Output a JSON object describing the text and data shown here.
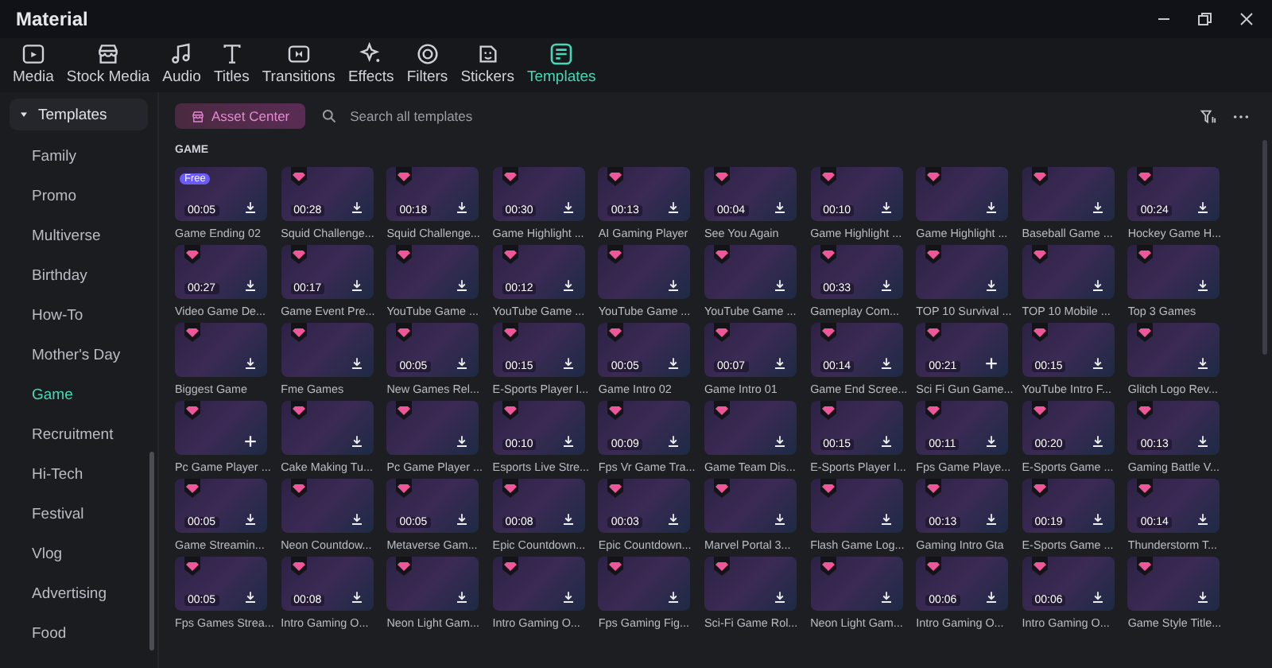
{
  "window": {
    "title": "Material"
  },
  "toolbar": [
    {
      "label": "Media",
      "selected": false
    },
    {
      "label": "Stock Media",
      "selected": false
    },
    {
      "label": "Audio",
      "selected": false
    },
    {
      "label": "Titles",
      "selected": false
    },
    {
      "label": "Transitions",
      "selected": false
    },
    {
      "label": "Effects",
      "selected": false
    },
    {
      "label": "Filters",
      "selected": false
    },
    {
      "label": "Stickers",
      "selected": false
    },
    {
      "label": "Templates",
      "selected": true
    }
  ],
  "sidebar": {
    "header": {
      "label": "Templates",
      "expanded": true
    },
    "items": [
      {
        "label": "Family",
        "selected": false
      },
      {
        "label": "Promo",
        "selected": false
      },
      {
        "label": "Multiverse",
        "selected": false
      },
      {
        "label": "Birthday",
        "selected": false
      },
      {
        "label": "How-To",
        "selected": false
      },
      {
        "label": "Mother's Day",
        "selected": false
      },
      {
        "label": "Game",
        "selected": true
      },
      {
        "label": "Recruitment",
        "selected": false
      },
      {
        "label": "Hi-Tech",
        "selected": false
      },
      {
        "label": "Festival",
        "selected": false
      },
      {
        "label": "Vlog",
        "selected": false
      },
      {
        "label": "Advertising",
        "selected": false
      },
      {
        "label": "Food",
        "selected": false
      }
    ]
  },
  "asset_center": "Asset Center",
  "search": {
    "placeholder": "Search all templates"
  },
  "section_title": "GAME",
  "templates": [
    {
      "title": "Game Ending 02",
      "duration": "00:05",
      "badge": {
        "kind": "free",
        "label": "Free"
      },
      "kind": "download"
    },
    {
      "title": "Squid Challenge...",
      "duration": "00:28",
      "badge": {
        "kind": "premium"
      },
      "kind": "download"
    },
    {
      "title": "Squid Challenge...",
      "duration": "00:18",
      "badge": {
        "kind": "premium"
      },
      "kind": "download"
    },
    {
      "title": "Game Highlight ...",
      "duration": "00:30",
      "badge": {
        "kind": "premium"
      },
      "kind": "download"
    },
    {
      "title": "AI Gaming Player",
      "duration": "00:13",
      "badge": {
        "kind": "premium"
      },
      "kind": "download"
    },
    {
      "title": "See You Again",
      "duration": "00:04",
      "badge": {
        "kind": "premium"
      },
      "kind": "download"
    },
    {
      "title": "Game Highlight ...",
      "duration": "00:10",
      "badge": {
        "kind": "premium"
      },
      "kind": "download"
    },
    {
      "title": "Game Highlight ...",
      "badge": {
        "kind": "premium"
      },
      "kind": "download"
    },
    {
      "title": "Baseball Game ...",
      "badge": {
        "kind": "premium"
      },
      "kind": "download"
    },
    {
      "title": "Hockey Game H...",
      "duration": "00:24",
      "badge": {
        "kind": "premium"
      },
      "kind": "download"
    },
    {
      "title": "Video Game De...",
      "duration": "00:27",
      "badge": {
        "kind": "premium"
      },
      "kind": "download"
    },
    {
      "title": "Game Event Pre...",
      "duration": "00:17",
      "badge": {
        "kind": "premium"
      },
      "kind": "download"
    },
    {
      "title": "YouTube Game ...",
      "badge": {
        "kind": "premium"
      },
      "kind": "download"
    },
    {
      "title": "YouTube Game ...",
      "duration": "00:12",
      "badge": {
        "kind": "premium"
      },
      "kind": "download"
    },
    {
      "title": "YouTube Game ...",
      "badge": {
        "kind": "premium"
      },
      "kind": "download"
    },
    {
      "title": "YouTube Game ...",
      "badge": {
        "kind": "premium"
      },
      "kind": "download"
    },
    {
      "title": "Gameplay Com...",
      "duration": "00:33",
      "badge": {
        "kind": "premium"
      },
      "kind": "download"
    },
    {
      "title": "TOP 10 Survival ...",
      "badge": {
        "kind": "premium"
      },
      "kind": "download"
    },
    {
      "title": "TOP 10 Mobile ...",
      "badge": {
        "kind": "premium"
      },
      "kind": "download"
    },
    {
      "title": "Top 3 Games",
      "badge": {
        "kind": "premium"
      },
      "kind": "download"
    },
    {
      "title": "Biggest Game",
      "badge": {
        "kind": "premium"
      },
      "kind": "download"
    },
    {
      "title": "Fme Games",
      "badge": {
        "kind": "premium"
      },
      "kind": "download"
    },
    {
      "title": "New Games Rel...",
      "duration": "00:05",
      "badge": {
        "kind": "premium"
      },
      "kind": "download"
    },
    {
      "title": "E-Sports Player I...",
      "duration": "00:15",
      "badge": {
        "kind": "premium"
      },
      "kind": "download"
    },
    {
      "title": "Game Intro 02",
      "duration": "00:05",
      "badge": {
        "kind": "premium"
      },
      "kind": "download"
    },
    {
      "title": "Game Intro 01",
      "duration": "00:07",
      "badge": {
        "kind": "premium"
      },
      "kind": "download"
    },
    {
      "title": "Game End Scree...",
      "duration": "00:14",
      "badge": {
        "kind": "premium"
      },
      "kind": "download"
    },
    {
      "title": "Sci Fi Gun Game...",
      "duration": "00:21",
      "badge": {
        "kind": "premium"
      },
      "kind": "add"
    },
    {
      "title": "YouTube Intro F...",
      "duration": "00:15",
      "badge": {
        "kind": "premium"
      },
      "kind": "download"
    },
    {
      "title": "Glitch Logo Rev...",
      "badge": {
        "kind": "premium"
      },
      "kind": "download"
    },
    {
      "title": "Pc Game Player ...",
      "badge": {
        "kind": "premium"
      },
      "kind": "add"
    },
    {
      "title": "Cake Making Tu...",
      "badge": {
        "kind": "premium"
      },
      "kind": "download"
    },
    {
      "title": "Pc Game Player ...",
      "badge": {
        "kind": "premium"
      },
      "kind": "download"
    },
    {
      "title": "Esports Live Stre...",
      "duration": "00:10",
      "badge": {
        "kind": "premium"
      },
      "kind": "download"
    },
    {
      "title": "Fps Vr Game Tra...",
      "duration": "00:09",
      "badge": {
        "kind": "premium"
      },
      "kind": "download"
    },
    {
      "title": "Game Team Dis...",
      "badge": {
        "kind": "premium"
      },
      "kind": "download"
    },
    {
      "title": "E-Sports Player I...",
      "duration": "00:15",
      "badge": {
        "kind": "premium"
      },
      "kind": "download"
    },
    {
      "title": "Fps Game Playe...",
      "duration": "00:11",
      "badge": {
        "kind": "premium"
      },
      "kind": "download"
    },
    {
      "title": "E-Sports Game ...",
      "duration": "00:20",
      "badge": {
        "kind": "premium"
      },
      "kind": "download"
    },
    {
      "title": "Gaming Battle V...",
      "duration": "00:13",
      "badge": {
        "kind": "premium"
      },
      "kind": "download"
    },
    {
      "title": "Game Streamin...",
      "duration": "00:05",
      "badge": {
        "kind": "premium"
      },
      "kind": "download"
    },
    {
      "title": "Neon Countdow...",
      "badge": {
        "kind": "premium"
      },
      "kind": "download"
    },
    {
      "title": "Metaverse Gam...",
      "duration": "00:05",
      "badge": {
        "kind": "premium"
      },
      "kind": "download"
    },
    {
      "title": "Epic Countdown...",
      "duration": "00:08",
      "badge": {
        "kind": "premium"
      },
      "kind": "download"
    },
    {
      "title": "Epic Countdown...",
      "duration": "00:03",
      "badge": {
        "kind": "premium"
      },
      "kind": "download"
    },
    {
      "title": "Marvel Portal 3...",
      "badge": {
        "kind": "premium"
      },
      "kind": "download"
    },
    {
      "title": "Flash Game Log...",
      "badge": {
        "kind": "premium"
      },
      "kind": "download"
    },
    {
      "title": "Gaming Intro Gta",
      "duration": "00:13",
      "badge": {
        "kind": "premium"
      },
      "kind": "download"
    },
    {
      "title": "E-Sports Game ...",
      "duration": "00:19",
      "badge": {
        "kind": "premium"
      },
      "kind": "download"
    },
    {
      "title": "Thunderstorm T...",
      "duration": "00:14",
      "badge": {
        "kind": "premium"
      },
      "kind": "download"
    },
    {
      "title": "Fps Games Strea...",
      "duration": "00:05",
      "badge": {
        "kind": "premium"
      },
      "kind": "download"
    },
    {
      "title": "Intro Gaming O...",
      "duration": "00:08",
      "badge": {
        "kind": "premium"
      },
      "kind": "download"
    },
    {
      "title": "Neon Light Gam...",
      "badge": {
        "kind": "premium"
      },
      "kind": "download"
    },
    {
      "title": "Intro Gaming O...",
      "badge": {
        "kind": "premium"
      },
      "kind": "download"
    },
    {
      "title": "Fps Gaming Fig...",
      "badge": {
        "kind": "premium"
      },
      "kind": "download"
    },
    {
      "title": "Sci-Fi Game Rol...",
      "badge": {
        "kind": "premium"
      },
      "kind": "download"
    },
    {
      "title": "Neon Light Gam...",
      "badge": {
        "kind": "premium"
      },
      "kind": "download"
    },
    {
      "title": "Intro Gaming O...",
      "duration": "00:06",
      "badge": {
        "kind": "premium"
      },
      "kind": "download"
    },
    {
      "title": "Intro Gaming O...",
      "duration": "00:06",
      "badge": {
        "kind": "premium"
      },
      "kind": "download"
    },
    {
      "title": "Game Style Title...",
      "badge": {
        "kind": "premium"
      },
      "kind": "download"
    }
  ]
}
